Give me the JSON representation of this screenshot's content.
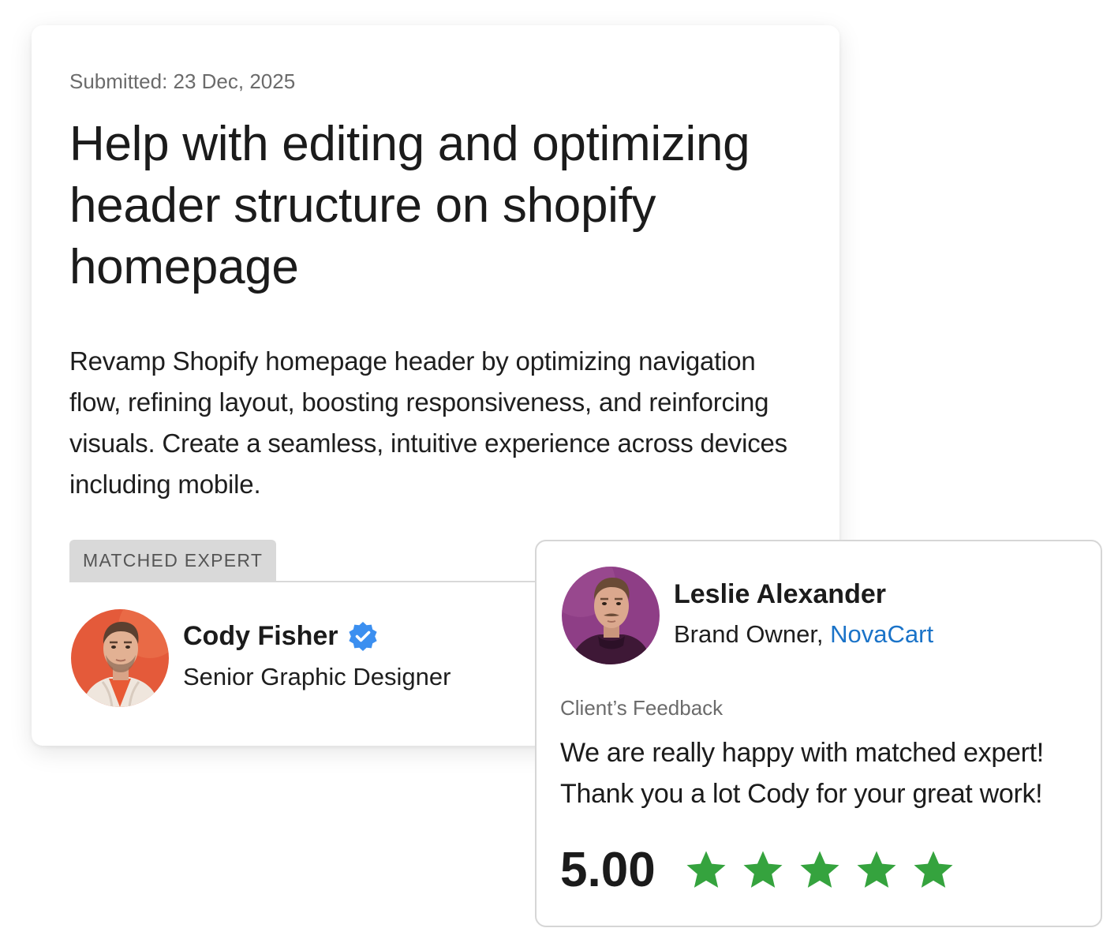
{
  "request": {
    "submitted": "Submitted: 23 Dec, 2025",
    "title": "Help with editing and optimizing header structure on shopify homepage",
    "description": "Revamp Shopify homepage header by optimizing navigation flow, refining layout, boosting responsiveness, and reinforcing visuals. Create a seamless, intuitive experience across devices including mobile.",
    "matched_label": "MATCHED EXPERT",
    "expert": {
      "name": "Cody Fisher",
      "role": "Senior Graphic Designer",
      "verified_icon": "verified-badge-icon",
      "avatar_bg": "#e45a3a"
    }
  },
  "feedback": {
    "client": {
      "name": "Leslie Alexander",
      "role_prefix": "Brand Owner, ",
      "company": "NovaCart",
      "avatar_bg": "#8e3e86"
    },
    "label": "Client’s Feedback",
    "text": "We are really happy with matched expert! Thank you a lot Cody for your great work!",
    "rating": "5.00",
    "stars": 5
  },
  "colors": {
    "accent_link": "#1a73c8",
    "verified": "#3b8ff0",
    "star": "#35a33e",
    "tag_bg": "#d9d9d9"
  }
}
